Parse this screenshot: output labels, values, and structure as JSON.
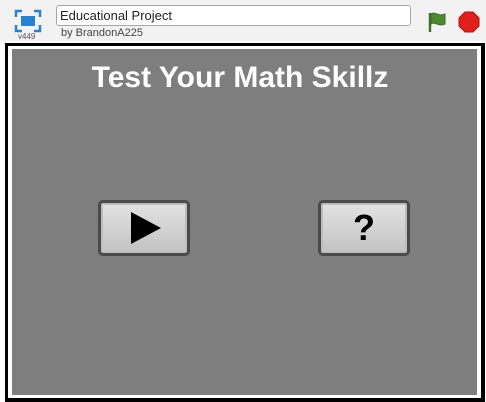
{
  "toolbar": {
    "project_title": "Educational Project",
    "author": "by BrandonA225",
    "version": "v449"
  },
  "game": {
    "title": "Test Your Math Skillz",
    "help_button_label": "?",
    "background_color": "#7e7e7e"
  },
  "icons": {
    "fullscreen": "fullscreen-icon",
    "green_flag": "green-flag-icon",
    "stop": "stop-sign-icon",
    "play": "play-triangle-icon"
  },
  "colors": {
    "flag_green": "#4d8a33",
    "stop_red": "#e0201b",
    "fullscreen_blue": "#2a7fd1"
  }
}
